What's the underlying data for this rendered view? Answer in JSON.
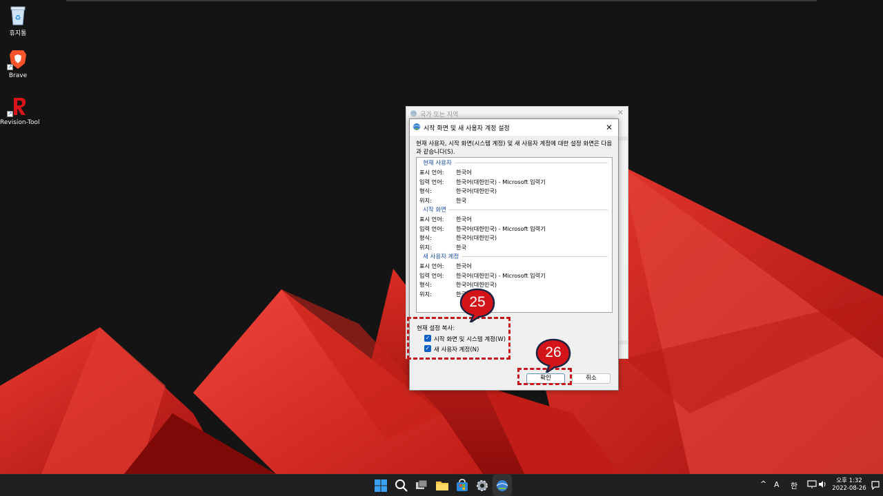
{
  "desktop": {
    "icons": [
      {
        "label": "휴지통",
        "icon": "recycle-bin-icon"
      },
      {
        "label": "Brave",
        "icon": "brave-icon"
      },
      {
        "label": "Revision-Tool",
        "icon": "revision-tool-icon"
      }
    ],
    "shortcut_glyph": "↗"
  },
  "back_dialog": {
    "title": "국가 또는 지역",
    "close_glyph": "✕"
  },
  "dialog": {
    "title": "시작 화면 및 새 사용자 계정 설정",
    "close_glyph": "✕",
    "description": "현재 사용자, 시작 화면(시스템 계정) 및 새 사용자 계정에 대한 설정 화면은 다음과 같습니다(S).",
    "sections": [
      {
        "header": "현재 사용자",
        "rows": [
          {
            "key": "표시 언어:",
            "value": "한국어"
          },
          {
            "key": "입력 언어:",
            "value": "한국어(대한민국) - Microsoft 입력기"
          },
          {
            "key": "형식:",
            "value": "한국어(대한민국)"
          },
          {
            "key": "위치:",
            "value": "한국"
          }
        ]
      },
      {
        "header": "시작 화면",
        "rows": [
          {
            "key": "표시 언어:",
            "value": "한국어"
          },
          {
            "key": "입력 언어:",
            "value": "한국어(대한민국) - Microsoft 입력기"
          },
          {
            "key": "형식:",
            "value": "한국어(대한민국)"
          },
          {
            "key": "위치:",
            "value": "한국"
          }
        ]
      },
      {
        "header": "새 사용자 계정",
        "rows": [
          {
            "key": "표시 언어:",
            "value": "한국어"
          },
          {
            "key": "입력 언어:",
            "value": "한국어(대한민국) - Microsoft 입력기"
          },
          {
            "key": "형식:",
            "value": "한국어(대한민국)"
          },
          {
            "key": "위치:",
            "value": "한국"
          }
        ]
      }
    ],
    "copy_label": "현재 설정 복사:",
    "checkboxes": [
      {
        "label": "시작 화면 및 시스템 계정(W)",
        "checked": true
      },
      {
        "label": "새 사용자 계정(N)",
        "checked": true
      }
    ],
    "check_glyph": "✓",
    "ok_label": "확인",
    "cancel_label": "취소"
  },
  "annotations": [
    {
      "number": "25"
    },
    {
      "number": "26"
    }
  ],
  "taskbar": {
    "tray": {
      "chevron": "^",
      "font_indicator": "A",
      "ime": "한",
      "time": "오후 1:32",
      "date": "2022-08-26"
    }
  },
  "colors": {
    "accent": "#0f5fc4",
    "annotation_red": "#c8151b",
    "callout_fill": "#d31419",
    "callout_border": "#1c2340",
    "section_header": "#1f4fa3"
  }
}
